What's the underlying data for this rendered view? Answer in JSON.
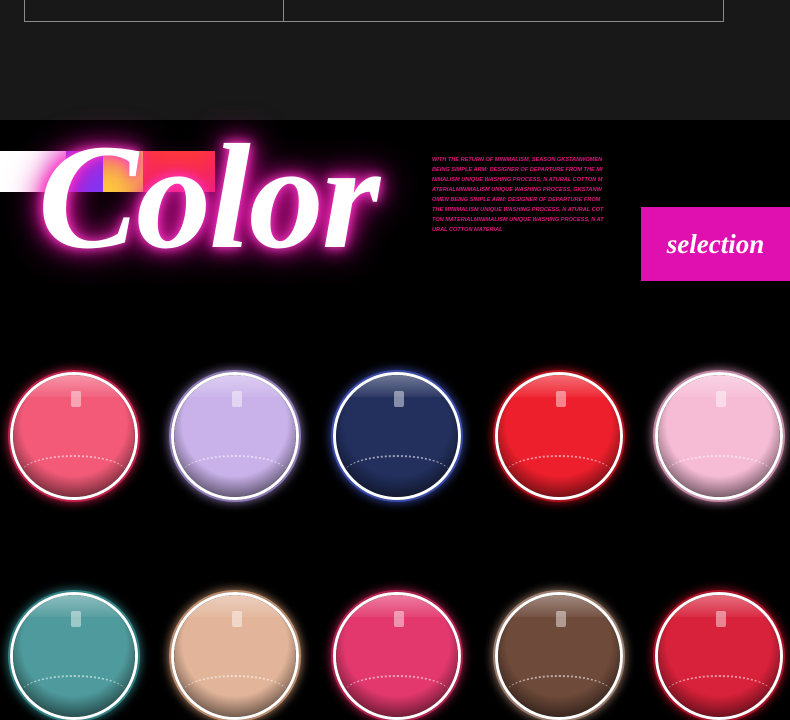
{
  "hero": {
    "title": "Color",
    "blurb": "WITH THE RETURN OF MINIMALISM, SEASON GKSTANWOMEN BEING SIMPLE ARM: DESIGNER OF DEPARTURE FROM THE MINIMALISM UNIQUE WASHING PROCESS, N ATURAL COTTON MATERIALMINIMALISM UNIQUE WASHING PROCESS, GKSTANWOMEN BEING SIMPLE ARM: DESIGNER OF DEPARTURE FROM THE MINIMALISM UNIQUE WASHING PROCESS, N ATURAL COTTON MATERIALMINIMALISM UNIQUE WASHING PROCESS, N ATURAL COTTON MATERIAL",
    "selection_label": "selection"
  },
  "swatch_bar": [
    "#ffffff",
    "#7a3cff",
    "#ffd836",
    "#ff3a3a"
  ],
  "colors": {
    "accent": "#e010b0",
    "text_pink": "#e0157f",
    "glow": "#ff1fb8"
  },
  "product_swatches": [
    {
      "name": "coral-pink",
      "fill": "#f25a78",
      "ring": "#c0204a"
    },
    {
      "name": "lavender",
      "fill": "#c9b2ea",
      "ring": "#8e7bb5"
    },
    {
      "name": "navy",
      "fill": "#23305e",
      "ring": "#3a4aa8"
    },
    {
      "name": "red",
      "fill": "#ee1f2c",
      "ring": "#b0101d"
    },
    {
      "name": "light-pink",
      "fill": "#f6bcd6",
      "ring": "#c68aa8"
    },
    {
      "name": "teal",
      "fill": "#4f9a9c",
      "ring": "#2f7e82"
    },
    {
      "name": "nude",
      "fill": "#e2b59a",
      "ring": "#b88a6a"
    },
    {
      "name": "rose",
      "fill": "#e3386e",
      "ring": "#b0204f"
    },
    {
      "name": "brown",
      "fill": "#6e4a3a",
      "ring": "#9a7a6a"
    },
    {
      "name": "crimson",
      "fill": "#d8213a",
      "ring": "#a81025"
    }
  ]
}
